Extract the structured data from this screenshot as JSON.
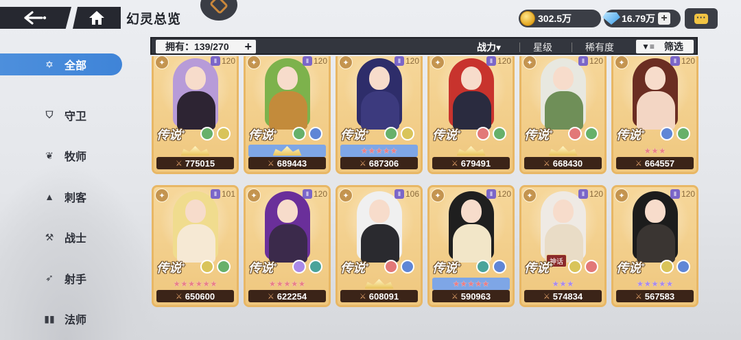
{
  "header": {
    "title": "幻灵总览",
    "gold": "302.5万",
    "gems": "16.79万",
    "gem_plus": "+"
  },
  "filter": {
    "owned_label": "拥有：139/270",
    "owned_plus": "+",
    "sort_power": "战力▾",
    "sort_star": "星级",
    "sort_rarity": "稀有度",
    "filter_label": "筛选"
  },
  "sidebar": {
    "items": [
      {
        "label": "全部",
        "icon": "star-outline-icon",
        "active": true
      },
      {
        "label": "守卫",
        "icon": "shield-icon",
        "active": false
      },
      {
        "label": "牧师",
        "icon": "wings-icon",
        "active": false
      },
      {
        "label": "刺客",
        "icon": "dagger-icon",
        "active": false
      },
      {
        "label": "战士",
        "icon": "axe-icon",
        "active": false
      },
      {
        "label": "射手",
        "icon": "bow-icon",
        "active": false
      },
      {
        "label": "法师",
        "icon": "book-icon",
        "active": false
      }
    ]
  },
  "cards": [
    {
      "power": "775015",
      "rarity": "传说",
      "level": "120",
      "stars": "crown",
      "star_bg": "plain",
      "hair": "#b79bd8",
      "body": "#2d2433",
      "e1": "#67b06a",
      "e2": "#d9c45a"
    },
    {
      "power": "689443",
      "rarity": "传说",
      "level": "120",
      "stars": "crown",
      "star_bg": "blue",
      "hair": "#7db24c",
      "body": "#c38b3b",
      "e1": "#67b06a",
      "e2": "#5f86d6"
    },
    {
      "power": "687306",
      "rarity": "传说",
      "level": "120",
      "stars": "★★★★★",
      "star_bg": "blue",
      "hair": "#2e2d6a",
      "body": "#3c3a7e",
      "e1": "#67b06a",
      "e2": "#d9c45a"
    },
    {
      "power": "679491",
      "rarity": "传说",
      "level": "120",
      "stars": "crown",
      "star_bg": "plain",
      "hair": "#c8332d",
      "body": "#2a2b3f",
      "e1": "#e27878",
      "e2": "#67b06a"
    },
    {
      "power": "668430",
      "rarity": "传说",
      "level": "120",
      "stars": "crown",
      "star_bg": "plain",
      "hair": "#e8e8e0",
      "body": "#6f8f58",
      "e1": "#e27878",
      "e2": "#67b06a"
    },
    {
      "power": "664557",
      "rarity": "传说",
      "level": "120",
      "stars": "★★★",
      "star_bg": "plain",
      "hair": "#6b2d22",
      "body": "#f3d6c4",
      "e1": "#5f86d6",
      "e2": "#67b06a"
    },
    {
      "power": "650600",
      "rarity": "传说",
      "level": "101",
      "stars": "★★★★★★",
      "star_bg": "plain",
      "hair": "#f0dc8e",
      "body": "#f6e9d4",
      "e1": "#d9c45a",
      "e2": "#67b06a"
    },
    {
      "power": "622254",
      "rarity": "传说",
      "level": "120",
      "stars": "★★★★★",
      "star_bg": "plain",
      "hair": "#6a2f9a",
      "body": "#3b2a4b",
      "e1": "#a98ae8",
      "e2": "#4aa39a"
    },
    {
      "power": "608091",
      "rarity": "传说",
      "level": "106",
      "stars": "crown",
      "star_bg": "plain",
      "hair": "#f0f0f0",
      "body": "#2a2a2f",
      "e1": "#e27878",
      "e2": "#5f86d6"
    },
    {
      "power": "590963",
      "rarity": "传说",
      "level": "120",
      "stars": "★★★★★",
      "star_bg": "blue",
      "hair": "#1f1f1f",
      "body": "#f2e6c8",
      "e1": "#4aa39a",
      "e2": "#5f86d6"
    },
    {
      "power": "574834",
      "rarity": "传说",
      "level": "120",
      "stars": "★★★",
      "star_bg": "plain",
      "star_color": "purple",
      "hair": "#efeae4",
      "body": "#e9dcc6",
      "e1": "#d9c45a",
      "e2": "#e27878",
      "tag": "神话"
    },
    {
      "power": "567583",
      "rarity": "传说",
      "level": "120",
      "stars": "★★★★★",
      "star_bg": "plain",
      "star_color": "purple",
      "hair": "#1c1c1c",
      "body": "#3a3532",
      "e1": "#d9c45a",
      "e2": "#5f86d6"
    }
  ]
}
